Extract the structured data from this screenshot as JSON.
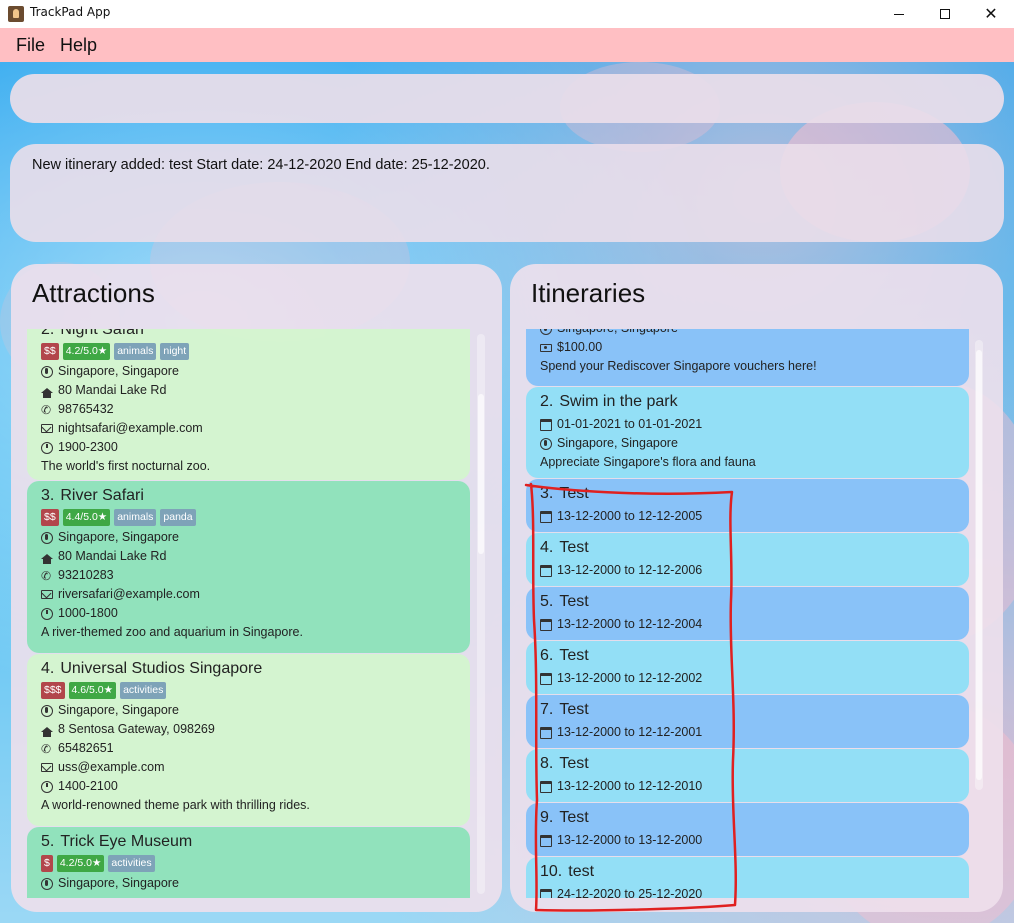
{
  "window": {
    "title": "TrackPad App",
    "minimize_glyph": "",
    "close_glyph": "✕"
  },
  "menu": {
    "items": [
      {
        "label": "File"
      },
      {
        "label": "Help"
      }
    ]
  },
  "command": {
    "value": ""
  },
  "result": {
    "text": "New itinerary added: test Start date: 24-12-2020 End date: 25-12-2020."
  },
  "attractions": {
    "title": "Attractions",
    "items": [
      {
        "index": "2.",
        "name": "Night Safari",
        "price": "$$",
        "rating": "4.2/5.0★",
        "tags": [
          "animals",
          "night"
        ],
        "location": "Singapore, Singapore",
        "address": "80 Mandai Lake Rd",
        "phone": "98765432",
        "email": "nightsafari@example.com",
        "hours": "1900-2300",
        "description": "The world's first nocturnal zoo."
      },
      {
        "index": "3.",
        "name": "River Safari",
        "price": "$$",
        "rating": "4.4/5.0★",
        "tags": [
          "animals",
          "panda"
        ],
        "location": "Singapore, Singapore",
        "address": "80 Mandai Lake Rd",
        "phone": "93210283",
        "email": "riversafari@example.com",
        "hours": "1000-1800",
        "description": "A river-themed zoo and aquarium in Singapore."
      },
      {
        "index": "4.",
        "name": "Universal Studios Singapore",
        "price": "$$$",
        "rating": "4.6/5.0★",
        "tags": [
          "activities"
        ],
        "location": "Singapore, Singapore",
        "address": "8 Sentosa Gateway, 098269",
        "phone": "65482651",
        "email": "uss@example.com",
        "hours": "1400-2100",
        "description": "A world-renowned theme park with thrilling rides."
      },
      {
        "index": "5.",
        "name": "Trick Eye Museum",
        "price": "$",
        "rating": "4.2/5.0★",
        "tags": [
          "activities"
        ],
        "location": "Singapore, Singapore"
      }
    ]
  },
  "itineraries": {
    "title": "Itineraries",
    "first_partial": {
      "location": "Singapore, Singapore",
      "budget": "$100.00",
      "description": "Spend your Rediscover Singapore vouchers here!"
    },
    "swim": {
      "index": "2.",
      "name": "Swim in the park",
      "dates": "01-01-2021 to 01-01-2021",
      "location": "Singapore, Singapore",
      "description": "Appreciate Singapore's flora and fauna"
    },
    "items": [
      {
        "index": "3.",
        "name": "Test",
        "dates": "13-12-2000 to 12-12-2005"
      },
      {
        "index": "4.",
        "name": "Test",
        "dates": "13-12-2000 to 12-12-2006"
      },
      {
        "index": "5.",
        "name": "Test",
        "dates": "13-12-2000 to 12-12-2004"
      },
      {
        "index": "6.",
        "name": "Test",
        "dates": "13-12-2000 to 12-12-2002"
      },
      {
        "index": "7.",
        "name": "Test",
        "dates": "13-12-2000 to 12-12-2001"
      },
      {
        "index": "8.",
        "name": "Test",
        "dates": "13-12-2000 to 12-12-2010"
      },
      {
        "index": "9.",
        "name": "Test",
        "dates": "13-12-2000 to 13-12-2000"
      },
      {
        "index": "10.",
        "name": "test",
        "dates": "24-12-2020 to 25-12-2020"
      }
    ]
  },
  "colors": {
    "menubar": "#ffbfc3",
    "price_tag": "#b2464b",
    "rating_tag": "#3fa845",
    "label_tag": "#7ea3b8",
    "annotation": "#e02020"
  }
}
